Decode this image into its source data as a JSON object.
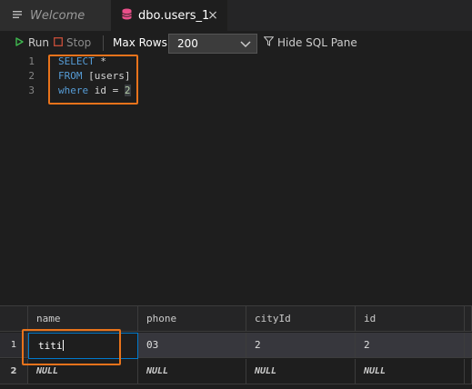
{
  "tabs": [
    {
      "label": "Welcome",
      "icon": "list-icon",
      "active": false
    },
    {
      "label": "dbo.users_1",
      "icon": "database-icon",
      "active": true,
      "close": "×"
    }
  ],
  "toolbar": {
    "run_label": "Run",
    "stop_label": "Stop",
    "max_rows_label": "Max Rows:",
    "max_rows_value": "200",
    "hide_sql_label": "Hide SQL Pane"
  },
  "editor": {
    "lines": [
      {
        "num": "1",
        "kw": "SELECT",
        "rest": " *"
      },
      {
        "num": "2",
        "kw": "FROM",
        "rest": " [users]"
      },
      {
        "num": "3",
        "kw": "where",
        "rest_id": " id = ",
        "value": "2"
      }
    ]
  },
  "results": {
    "columns": [
      "name",
      "phone",
      "cityId",
      "id"
    ],
    "rows": [
      {
        "num": "1",
        "cells": [
          "titi",
          "03",
          "2",
          "2"
        ]
      },
      {
        "num": "2",
        "cells": [
          "NULL",
          "NULL",
          "NULL",
          "NULL"
        ]
      }
    ]
  },
  "colors": {
    "accent": "#007acc",
    "highlight": "#e8731b",
    "keyword": "#569cd6",
    "run": "#3fb950"
  }
}
